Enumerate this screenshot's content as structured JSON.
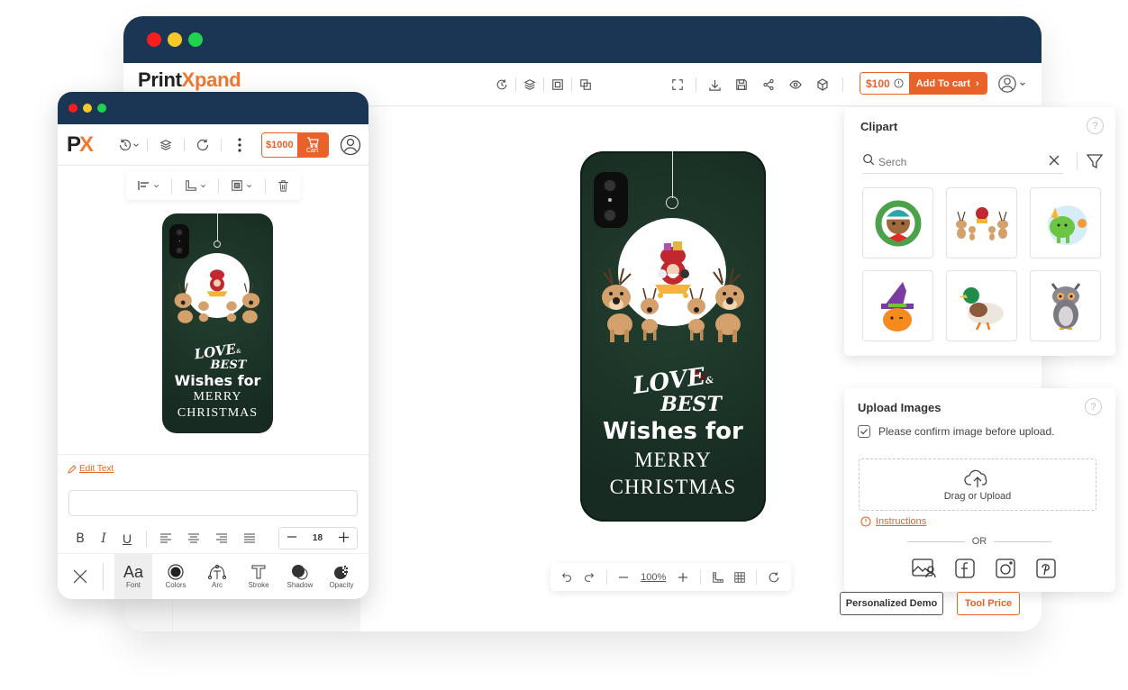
{
  "desktop": {
    "window_controls": [
      "close",
      "minimize",
      "maximize"
    ],
    "logo": {
      "part1": "Print",
      "part2": "Xpand"
    },
    "toolbar_left_icons": [
      "history-icon",
      "layers-icon",
      "group-icon",
      "duplicate-icon"
    ],
    "toolbar_right_icons": [
      "fullscreen-icon",
      "download-icon",
      "save-icon",
      "share-icon",
      "preview-icon",
      "3d-view-icon"
    ],
    "price": "$100",
    "add_to_cart_label": "Add To cart",
    "canvas": {
      "design_text": {
        "love": "LOVE",
        "amp": "&",
        "best": "BEST",
        "wishes": "Wishes for",
        "merry": "MERRY",
        "christmas": "CHRISTMAS"
      }
    },
    "zoom_bar": {
      "zoom_level": "100%"
    },
    "clipart": {
      "title": "Clipart",
      "search_placeholder": "Serch",
      "items": [
        {
          "name": "bear-wreath"
        },
        {
          "name": "reindeer-sleigh"
        },
        {
          "name": "dinosaur-party"
        },
        {
          "name": "pumpkin-witch-hat"
        },
        {
          "name": "mallard-duck"
        },
        {
          "name": "owl"
        }
      ]
    },
    "upload": {
      "title": "Upload Images",
      "confirm_label": "Please confirm image before upload.",
      "confirm_checked": true,
      "drop_label": "Drag or Upload",
      "instructions_label": "Instructions",
      "or_label": "OR",
      "sources": [
        "gallery",
        "facebook",
        "instagram",
        "pinterest"
      ]
    },
    "buttons": {
      "demo": "Personalized Demo",
      "tool_price": "Tool Price"
    }
  },
  "mobile": {
    "logo": {
      "p": "P",
      "x": "X"
    },
    "price": "$1000",
    "cart_label": "Cart",
    "edit_text_label": "Edit Text",
    "text_input_value": "",
    "font_size": "18",
    "bottom_tools": [
      {
        "label": "Font",
        "active": true
      },
      {
        "label": "Colors",
        "active": false
      },
      {
        "label": "Arc",
        "active": false
      },
      {
        "label": "Stroke",
        "active": false
      },
      {
        "label": "Shadow",
        "active": false
      },
      {
        "label": "Opacity",
        "active": false
      }
    ],
    "design_text": {
      "love": "LOVE",
      "amp": "&",
      "best": "BEST",
      "wishes": "Wishes for",
      "merry": "MERRY",
      "christmas": "CHRISTMAS"
    }
  },
  "colors": {
    "titlebar": "#1b3555",
    "accent": "#e8622a",
    "logo_orange": "#f07830",
    "phone_case": "#1d3a2e"
  }
}
